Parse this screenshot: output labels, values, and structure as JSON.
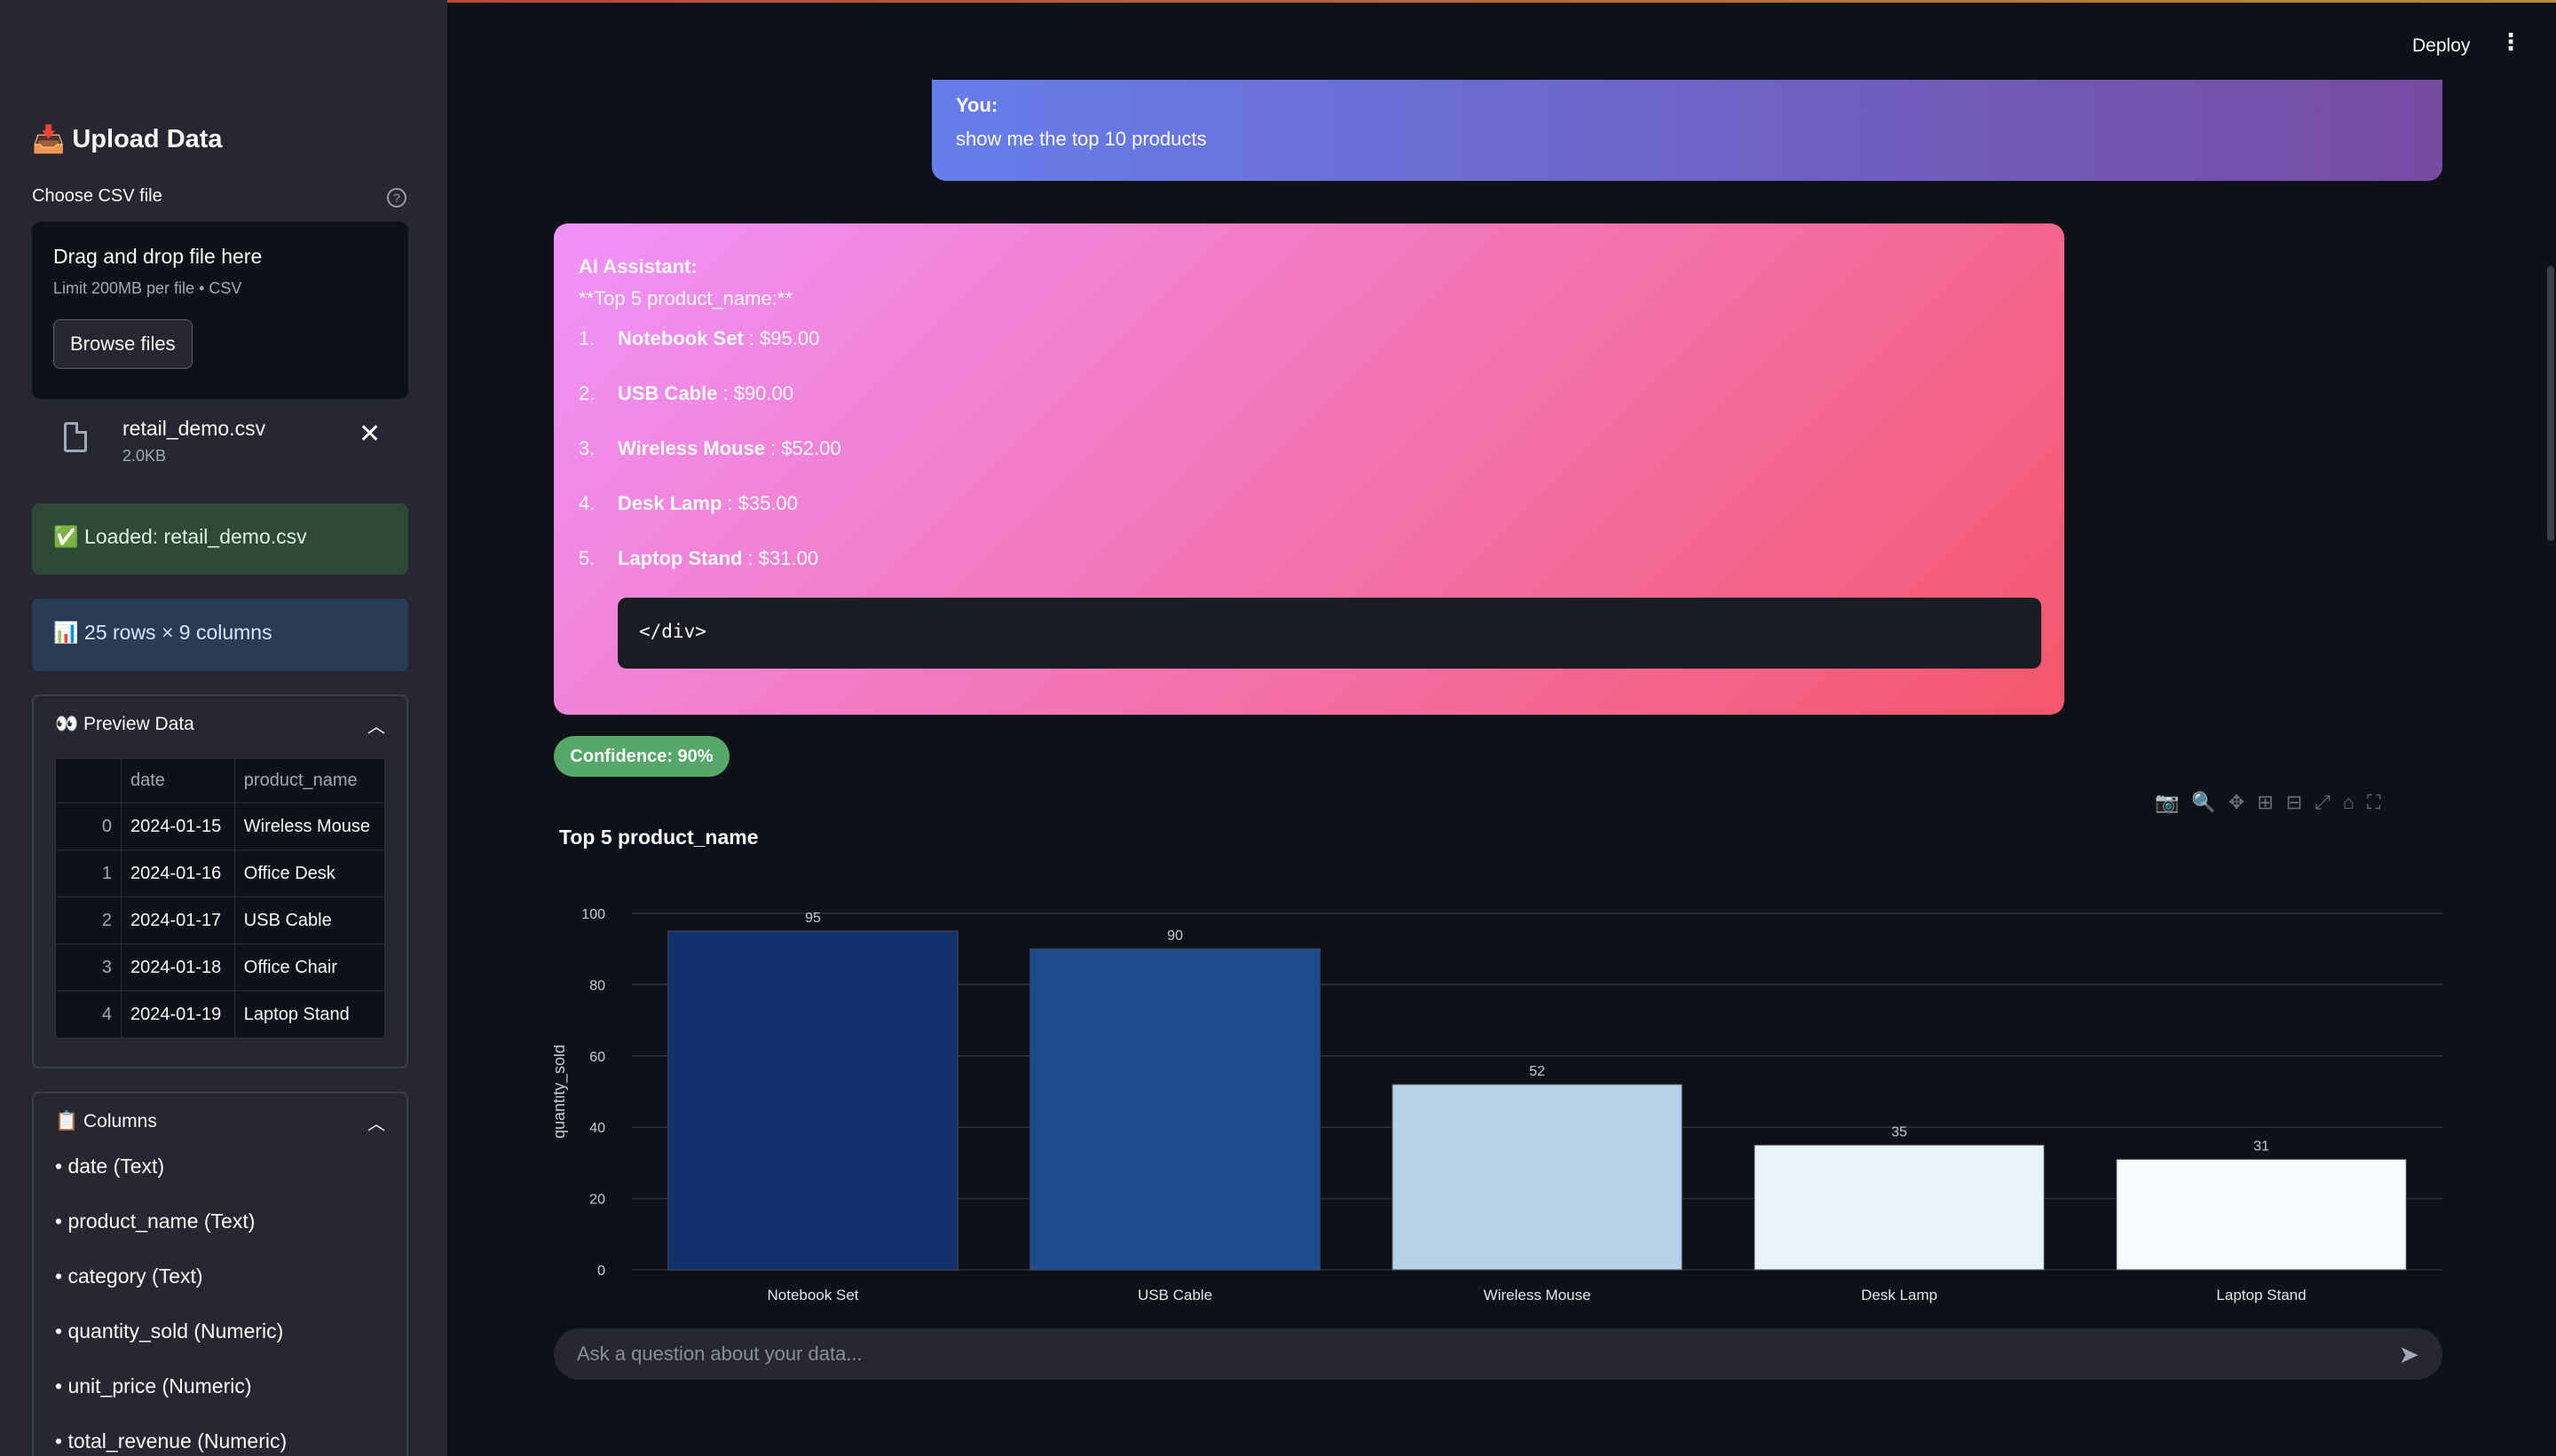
{
  "sidebar": {
    "title": "Upload Data",
    "title_icon": "inbox-tray-icon",
    "uploader_label": "Choose CSV file",
    "dropzone_title": "Drag and drop file here",
    "dropzone_limit": "Limit 200MB per file • CSV",
    "browse_label": "Browse files",
    "file": {
      "name": "retail_demo.csv",
      "size": "2.0KB"
    },
    "success_msg": "✅ Loaded: retail_demo.csv",
    "info_msg": "📊 25 rows × 9 columns",
    "preview": {
      "title": "👀 Preview Data",
      "columns": [
        "date",
        "product_name"
      ],
      "rows": [
        {
          "idx": "0",
          "date": "2024-01-15",
          "product_name": "Wireless Mouse"
        },
        {
          "idx": "1",
          "date": "2024-01-16",
          "product_name": "Office Desk"
        },
        {
          "idx": "2",
          "date": "2024-01-17",
          "product_name": "USB Cable"
        },
        {
          "idx": "3",
          "date": "2024-01-18",
          "product_name": "Office Chair"
        },
        {
          "idx": "4",
          "date": "2024-01-19",
          "product_name": "Laptop Stand"
        }
      ]
    },
    "columns_panel": {
      "title": "📋 Columns",
      "items": [
        "• date (Text)",
        "• product_name (Text)",
        "• category (Text)",
        "• quantity_sold (Numeric)",
        "• unit_price (Numeric)",
        "• total_revenue (Numeric)"
      ]
    }
  },
  "header": {
    "deploy_label": "Deploy"
  },
  "chat": {
    "user": {
      "who": "You:",
      "text": "show me the top 10 products"
    },
    "ai": {
      "who": "AI Assistant:",
      "header": "**Top 5 product_name:**",
      "items": [
        {
          "num": "1.",
          "name": "Notebook Set",
          "value": ": $95.00"
        },
        {
          "num": "2.",
          "name": "USB Cable",
          "value": ": $90.00"
        },
        {
          "num": "3.",
          "name": "Wireless Mouse",
          "value": ": $52.00"
        },
        {
          "num": "4.",
          "name": "Desk Lamp",
          "value": ": $35.00"
        },
        {
          "num": "5.",
          "name": "Laptop Stand",
          "value": ": $31.00"
        }
      ],
      "code": "</div>"
    },
    "confidence": "Confidence: 90%",
    "input_placeholder": "Ask a question about your data..."
  },
  "colors": {
    "bar_colors": [
      "#12306b",
      "#1d4a8c",
      "#b6d2e8",
      "#eaf2fb",
      "#f8fbff"
    ],
    "confidence_badge": "#55a868"
  },
  "chart_data": {
    "type": "bar",
    "title": "Top 5 product_name",
    "xlabel": "",
    "ylabel": "quantity_sold",
    "categories": [
      "Notebook Set",
      "USB Cable",
      "Wireless Mouse",
      "Desk Lamp",
      "Laptop Stand"
    ],
    "values": [
      95,
      90,
      52,
      35,
      31
    ],
    "data_labels": [
      "95",
      "90",
      "52",
      "35",
      "31"
    ],
    "ylim": [
      0,
      100
    ],
    "yticks": [
      0,
      20,
      40,
      60,
      80,
      100
    ],
    "grid": true
  }
}
